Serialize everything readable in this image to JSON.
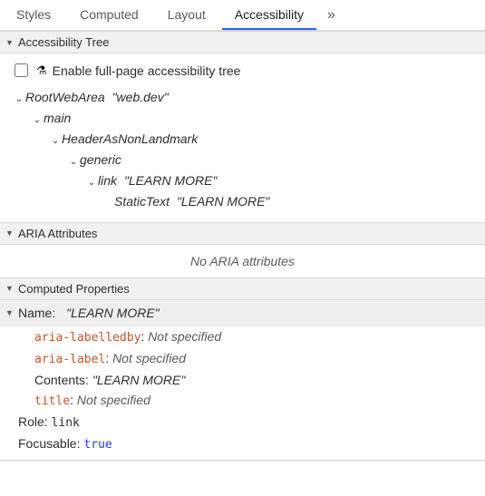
{
  "tabs": {
    "styles": "Styles",
    "computed": "Computed",
    "layout": "Layout",
    "accessibility": "Accessibility",
    "overflow": "»"
  },
  "sections": {
    "accessibilityTree": {
      "title": "Accessibility Tree",
      "checkboxLabel": "Enable full-page accessibility tree",
      "tree": {
        "n0": {
          "role": "RootWebArea",
          "name": "\"web.dev\""
        },
        "n1": {
          "role": "main"
        },
        "n2": {
          "role": "HeaderAsNonLandmark"
        },
        "n3": {
          "role": "generic"
        },
        "n4": {
          "role": "link",
          "name": "\"LEARN MORE\""
        },
        "n5": {
          "role": "StaticText",
          "name": "\"LEARN MORE\""
        }
      }
    },
    "aria": {
      "title": "ARIA Attributes",
      "empty": "No ARIA attributes"
    },
    "computedProps": {
      "title": "Computed Properties",
      "nameLabel": "Name:",
      "nameValue": "\"LEARN MORE\"",
      "sources": {
        "labelledby": {
          "attr": "aria-labelledby",
          "value": "Not specified"
        },
        "label": {
          "attr": "aria-label",
          "value": "Not specified"
        },
        "contents": {
          "attr": "Contents:",
          "value": "\"LEARN MORE\""
        },
        "title": {
          "attr": "title",
          "value": "Not specified"
        }
      },
      "roleLabel": "Role:",
      "roleValue": "link",
      "focusableLabel": "Focusable:",
      "focusableValue": "true"
    }
  }
}
